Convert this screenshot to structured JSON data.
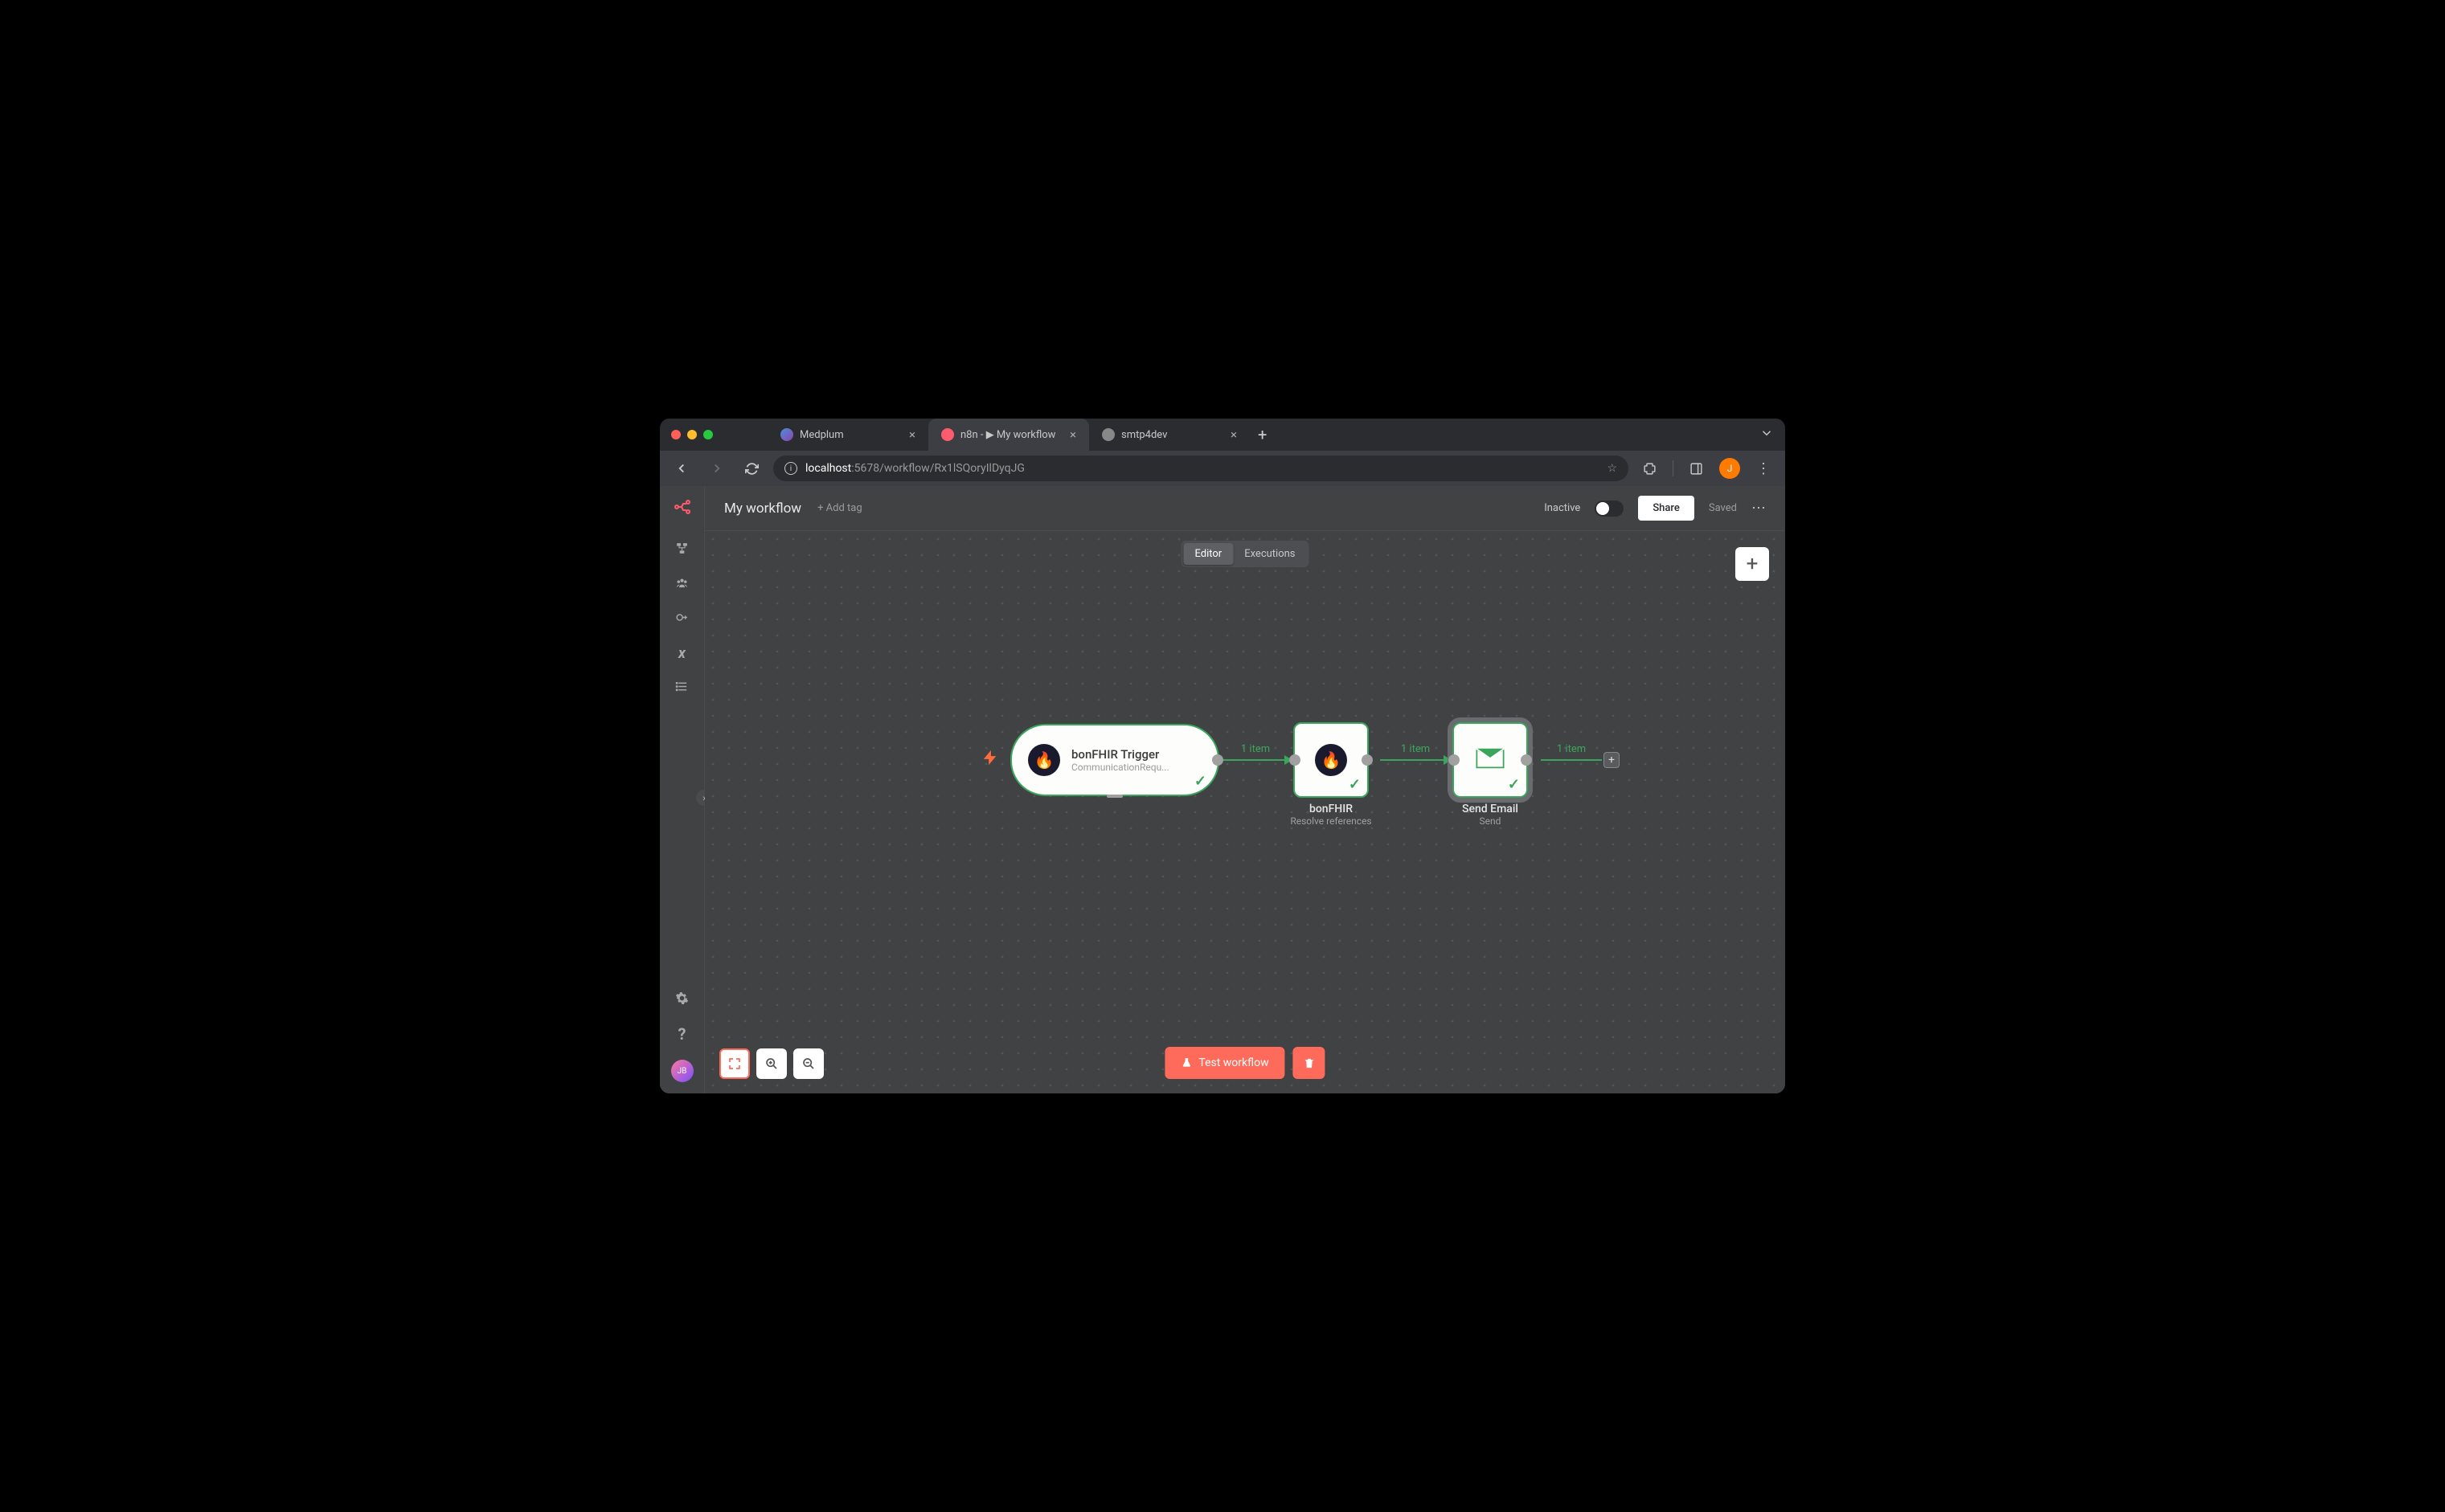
{
  "browser": {
    "tabs": [
      {
        "title": "Medplum",
        "active": false
      },
      {
        "title": "n8n - ▶ My workflow",
        "active": true
      },
      {
        "title": "smtp4dev",
        "active": false
      }
    ],
    "url_host": "localhost",
    "url_port_path": ":5678/workflow/Rx1lSQoryIlDyqJG",
    "avatar_initial": "J"
  },
  "header": {
    "workflow_name": "My workflow",
    "add_tag": "+ Add tag",
    "status": "Inactive",
    "share": "Share",
    "saved": "Saved"
  },
  "view_tabs": {
    "editor": "Editor",
    "executions": "Executions"
  },
  "sidebar_user": "JB",
  "nodes": {
    "trigger": {
      "title": "bonFHIR Trigger",
      "subtitle": "CommunicationRequ..."
    },
    "bonfhir": {
      "title": "bonFHIR",
      "subtitle": "Resolve references"
    },
    "email": {
      "title": "Send Email",
      "subtitle": "Send"
    }
  },
  "edges": {
    "e1": "1 item",
    "e2": "1 item",
    "e3": "1 item"
  },
  "actions": {
    "test": "Test workflow"
  }
}
